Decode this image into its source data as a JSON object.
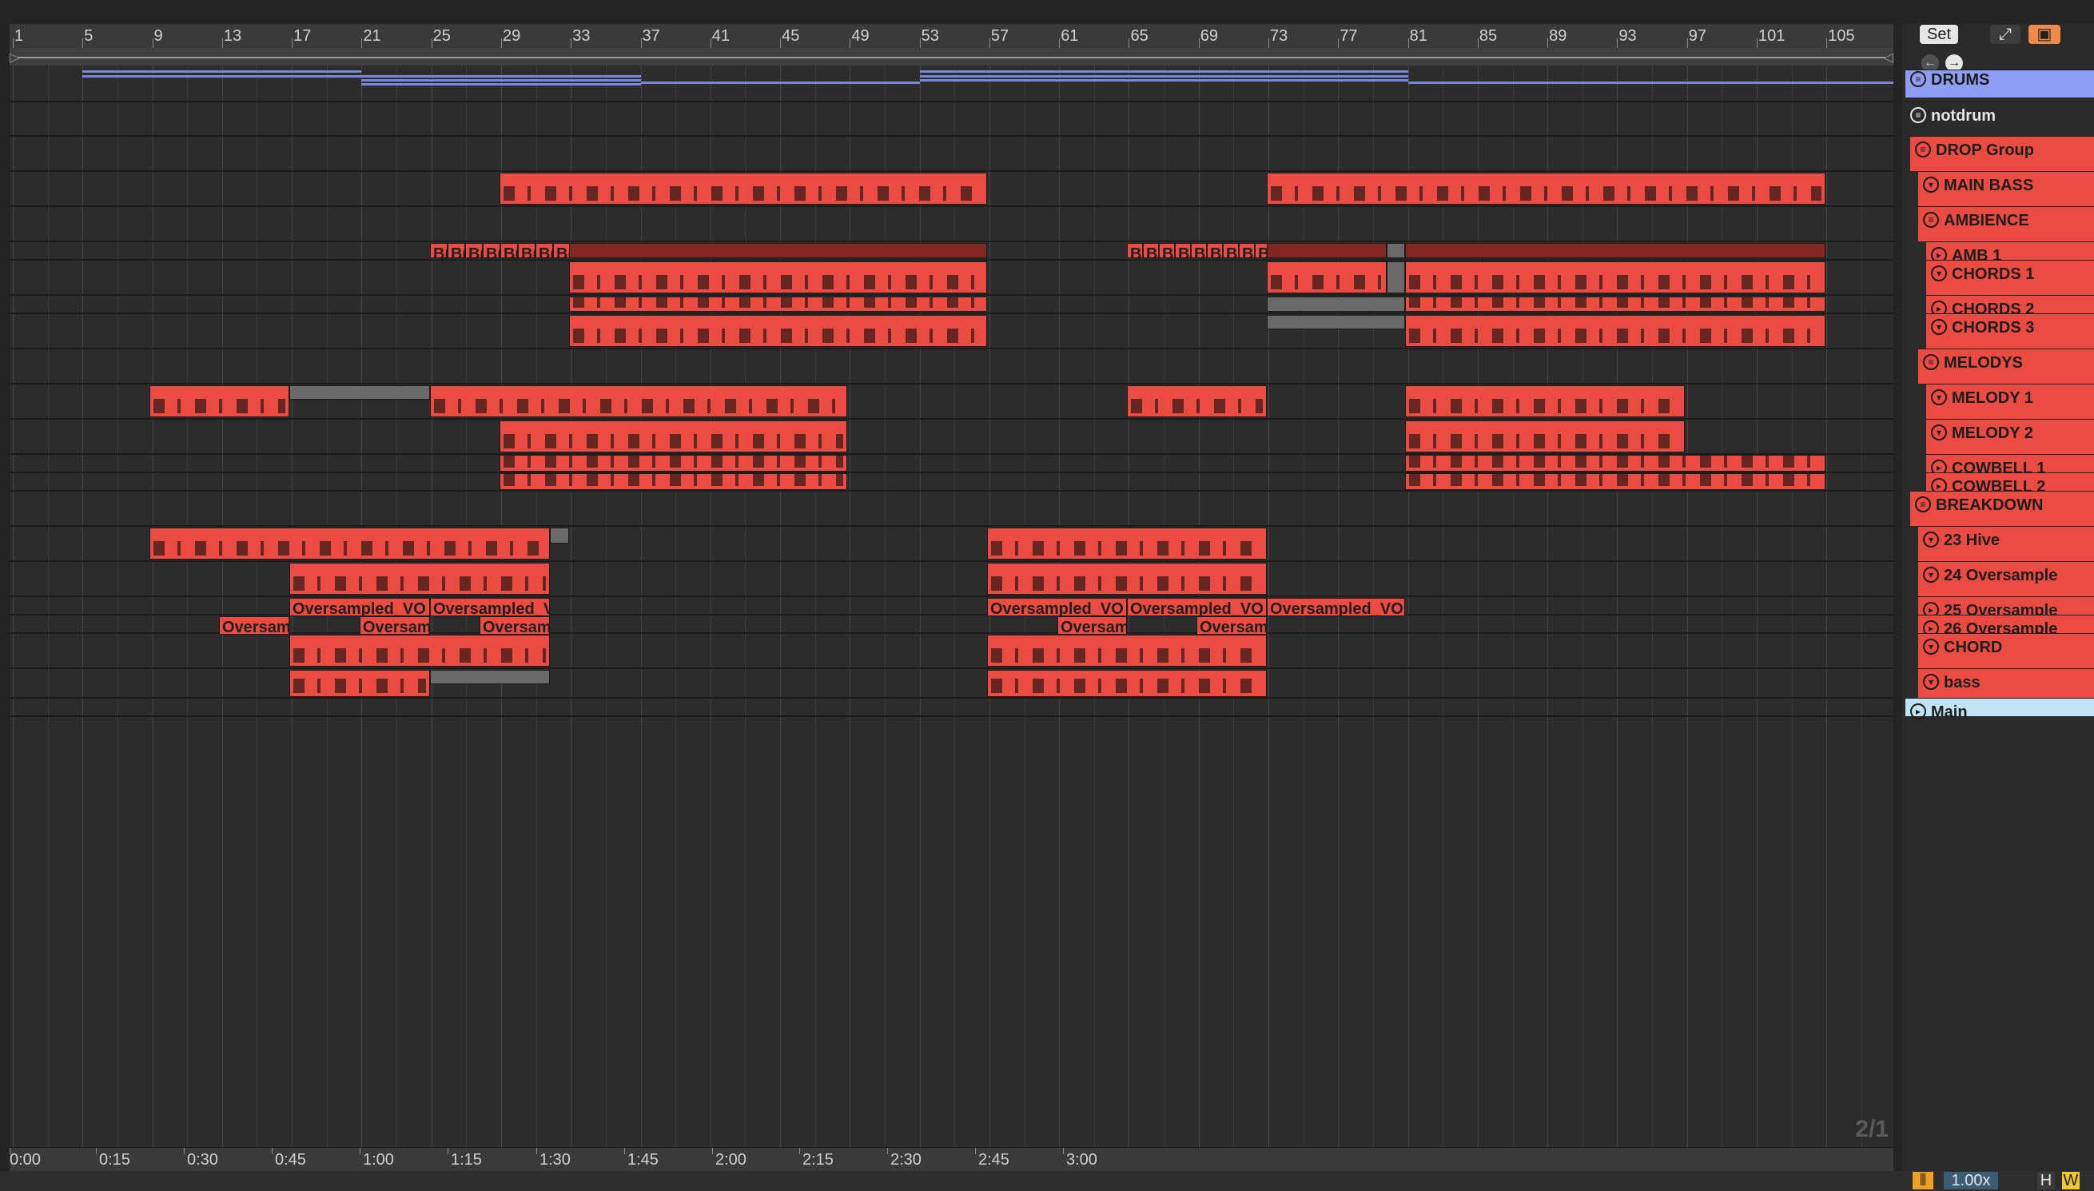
{
  "ruler": {
    "bars": [
      "1",
      "5",
      "9",
      "13",
      "17",
      "21",
      "25",
      "29",
      "33",
      "37",
      "41",
      "45",
      "49",
      "53",
      "57",
      "61",
      "65",
      "69",
      "73",
      "77",
      "81",
      "85",
      "89",
      "93",
      "97",
      "101",
      "105"
    ]
  },
  "time_ruler": {
    "labels": [
      "0:00",
      "0:15",
      "0:30",
      "0:45",
      "1:00",
      "1:15",
      "1:30",
      "1:45",
      "2:00",
      "2:15",
      "2:30",
      "2:45",
      "3:00"
    ]
  },
  "zoom_indicator": "2/1",
  "controls": {
    "set_label": "Set",
    "expand_icon": "expand-icon",
    "lock_icon": "lock-icon",
    "back_icon": "arrow-left-icon",
    "forward_icon": "arrow-right-icon"
  },
  "tracks": [
    {
      "name": "DRUMS"
    },
    {
      "name": "notdrum"
    },
    {
      "name": "DROP Group"
    },
    {
      "name": "MAIN BASS"
    },
    {
      "name": "AMBIENCE"
    },
    {
      "name": "AMB 1"
    },
    {
      "name": "CHORDS 1"
    },
    {
      "name": "CHORDS 2"
    },
    {
      "name": "CHORDS 3"
    },
    {
      "name": "MELODYS"
    },
    {
      "name": "MELODY 1"
    },
    {
      "name": "MELODY 2"
    },
    {
      "name": "COWBELL 1"
    },
    {
      "name": "COWBELL 2"
    },
    {
      "name": "BREAKDOWN"
    },
    {
      "name": "23 Hive"
    },
    {
      "name": "24 Oversample"
    },
    {
      "name": "25 Oversample"
    },
    {
      "name": "26 Oversample"
    },
    {
      "name": "CHORD"
    },
    {
      "name": "bass"
    },
    {
      "name": "Main"
    }
  ],
  "clip_names": {
    "amb": "B(",
    "overs_full": "Oversampled_VO",
    "overs_short": "Oversampled_V",
    "overs_tiny": "Oversam"
  },
  "bottom": {
    "zoom_value": "1.00x",
    "h_label": "H",
    "w_label": "W"
  },
  "colors": {
    "clip_red": "#ec4b42",
    "clip_dark": "#812621",
    "drums_blue": "#8e9ef4",
    "main_blue": "#bfe4f2"
  }
}
